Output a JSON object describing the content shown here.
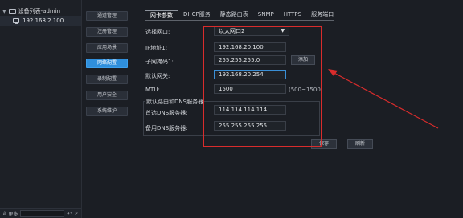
{
  "colors": {
    "accent": "#2f8fdc",
    "annotation": "#d92c2c"
  },
  "tree": {
    "root_label": "设备列表-admin",
    "device_ip": "192.168.2.100",
    "bottom_label": "更多"
  },
  "menu": {
    "items": [
      {
        "label": "通道管理",
        "active": false
      },
      {
        "label": "注册管理",
        "active": false
      },
      {
        "label": "应用场景",
        "active": false
      },
      {
        "label": "网络配置",
        "active": true
      },
      {
        "label": "录制配置",
        "active": false
      },
      {
        "label": "用户安全",
        "active": false
      },
      {
        "label": "系统维护",
        "active": false
      }
    ]
  },
  "tabs": [
    "网卡参数",
    "DHCP服务",
    "静态路由表",
    "SNMP",
    "HTTPS",
    "服务端口"
  ],
  "form": {
    "select_nic_label": "选择网口:",
    "select_nic_value": "以太网口2",
    "ip_label": "IP地址1:",
    "ip_value": "192.168.20.100",
    "mask_label": "子网掩码1:",
    "mask_value": "255.255.255.0",
    "add_button": "添加",
    "gateway_label": "默认网关:",
    "gateway_value": "192.168.20.254",
    "mtu_label": "MTU:",
    "mtu_value": "1500",
    "mtu_range": "(500~1500)",
    "dns_group_title": "默认路由和DNS服务器",
    "dns1_label": "首选DNS服务器:",
    "dns1_value": "114.114.114.114",
    "dns2_label": "备用DNS服务器:",
    "dns2_value": "255.255.255.255",
    "save_button": "保存",
    "refresh_button": "刷新"
  }
}
